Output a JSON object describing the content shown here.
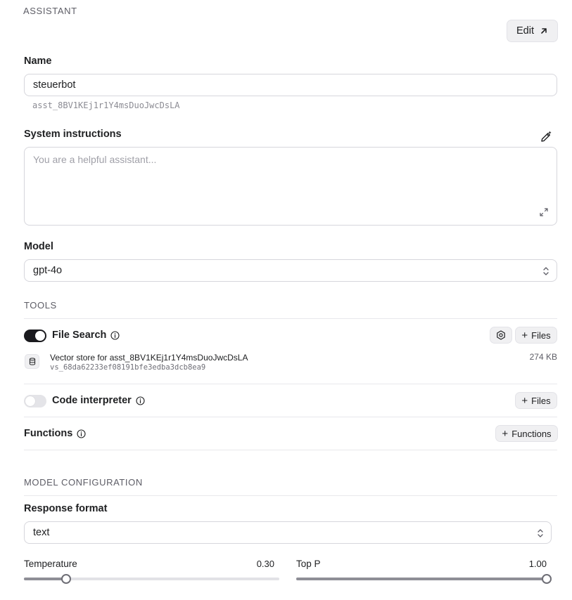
{
  "sections": {
    "assistant": "ASSISTANT",
    "tools": "TOOLS",
    "model_config": "MODEL CONFIGURATION"
  },
  "edit_button": {
    "label": "Edit",
    "icon": "arrow-up-right-icon"
  },
  "name": {
    "label": "Name",
    "value": "steuerbot",
    "assistant_id": "asst_8BV1KEj1r1Y4msDuoJwcDsLA"
  },
  "instructions": {
    "label": "System instructions",
    "placeholder": "You are a helpful assistant...",
    "value": ""
  },
  "model": {
    "label": "Model",
    "value": "gpt-4o"
  },
  "tools": {
    "file_search": {
      "label": "File Search",
      "enabled": true,
      "files_button": "Files",
      "vector_store": {
        "name": "Vector store for asst_8BV1KEj1r1Y4msDuoJwcDsLA",
        "id": "vs_68da62233ef08191bfe3edba3dcb8ea9",
        "size": "274 KB"
      }
    },
    "code_interpreter": {
      "label": "Code interpreter",
      "enabled": false,
      "files_button": "Files"
    },
    "functions": {
      "label": "Functions",
      "button": "Functions"
    }
  },
  "response_format": {
    "label": "Response format",
    "value": "text"
  },
  "temperature": {
    "label": "Temperature",
    "value_text": "0.30",
    "fraction": 0.165
  },
  "top_p": {
    "label": "Top P",
    "value_text": "1.00",
    "fraction": 1.0
  },
  "colors": {
    "toggle_on": "#1a1a1e",
    "toggle_off": "#e4e4e8",
    "slider_fill": "#8e8e96"
  }
}
